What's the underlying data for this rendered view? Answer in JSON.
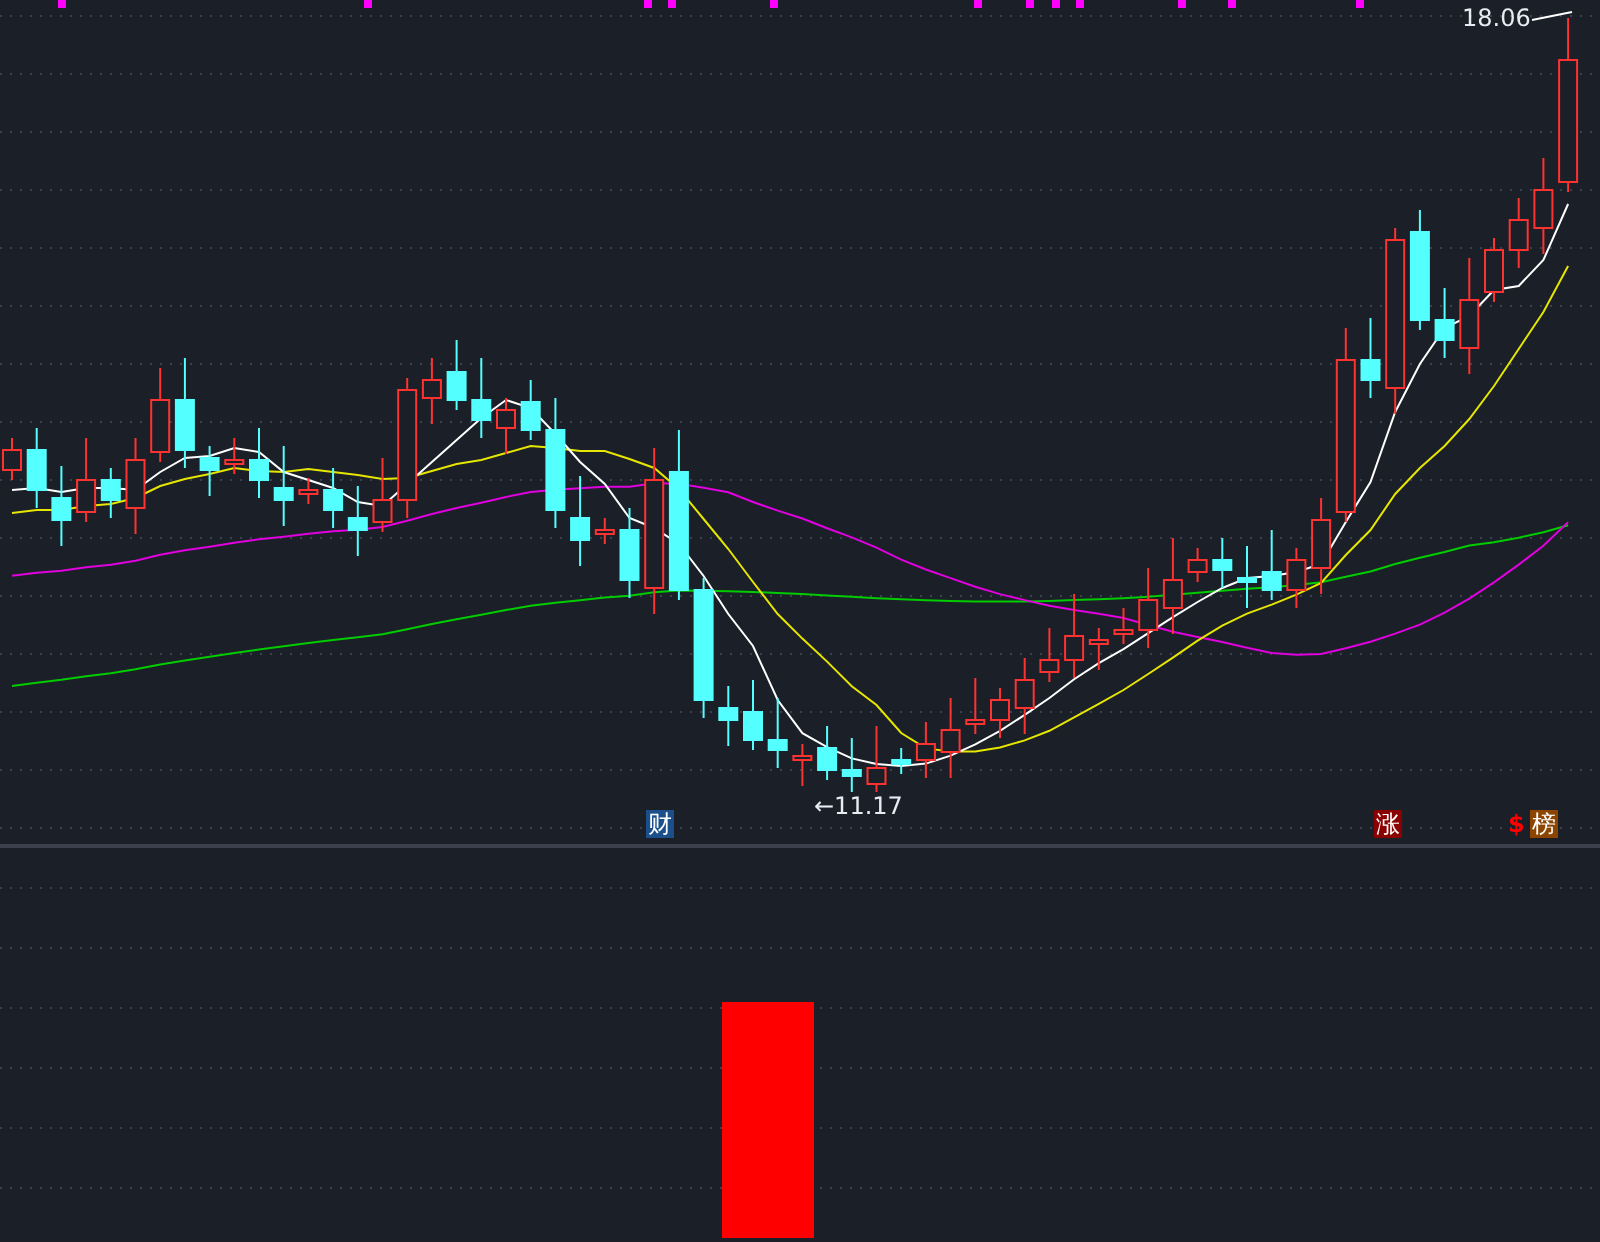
{
  "price_panel": {
    "high_label": "18.06",
    "low_label": "←11.17",
    "event_markers": [
      {
        "kind": "badge",
        "text": "财",
        "color": "#1b4f8c"
      },
      {
        "kind": "badge",
        "text": "涨",
        "color": "#8b0000"
      },
      {
        "kind": "glyph",
        "text": "$",
        "color": "#ff0000"
      },
      {
        "kind": "badge",
        "text": "榜",
        "color": "#8b4500"
      }
    ]
  }
}
